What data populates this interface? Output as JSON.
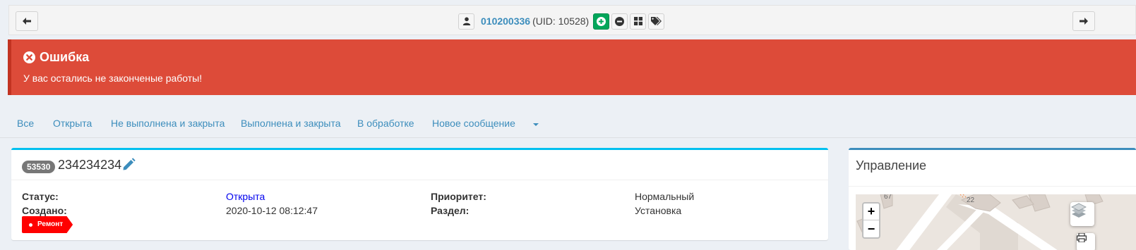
{
  "topbar": {
    "uid_link": "010200336",
    "uid_text": "(UID: 10528)"
  },
  "alert": {
    "title": "Ошибка",
    "message": "У вас остались не законченые работы!"
  },
  "tabs": [
    {
      "label": "Все"
    },
    {
      "label": "Открыта"
    },
    {
      "label": "Не выполнена и закрыта"
    },
    {
      "label": "Выполнена и закрыта"
    },
    {
      "label": "В обработке"
    },
    {
      "label": "Новое сообщение"
    }
  ],
  "ticket": {
    "id_badge": "53530",
    "title": "234234234",
    "status_label": "Статус:",
    "status_value": "Открыта",
    "created_label": "Создано:",
    "created_value": "2020-10-12 08:12:47",
    "priority_label": "Приоритет:",
    "priority_value": "Нормальный",
    "section_label": "Раздел:",
    "section_value": "Установка",
    "tag": "Ремонт"
  },
  "panel": {
    "title": "Управление",
    "map_labels": [
      "67",
      "22"
    ],
    "zoom_in": "+",
    "zoom_out": "−"
  },
  "colors": {
    "alert_bg": "#dd4b39",
    "link": "#3c8dbc",
    "box_accent": "#00c0ef",
    "tag_bg": "#ff0000",
    "add_button": "#00a65a"
  }
}
